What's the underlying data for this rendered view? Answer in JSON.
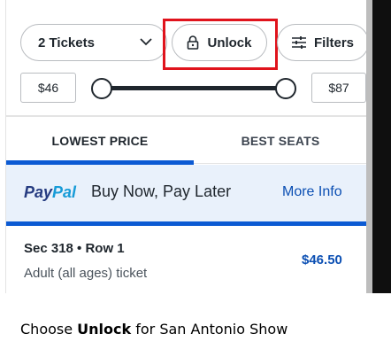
{
  "toolbar": {
    "ticket_select_label": "2 Tickets",
    "unlock_label": "Unlock",
    "filters_label": "Filters"
  },
  "price_range": {
    "min_label": "$46",
    "max_label": "$87",
    "min_value": 46,
    "max_value": 87
  },
  "tabs": [
    {
      "label": "LOWEST PRICE",
      "selected": true
    },
    {
      "label": "BEST SEATS",
      "selected": false
    }
  ],
  "paypal": {
    "logo_pay": "Pay",
    "logo_pal": "Pal",
    "tagline": "Buy Now, Pay Later",
    "more_info": "More Info"
  },
  "listing": {
    "section_row": "Sec 318 • Row 1",
    "ticket_type": "Adult (all ages) ticket",
    "price": "$46.50"
  },
  "caption": {
    "prefix": "Choose ",
    "emphasis": "Unlock",
    "suffix": " for San Antonio Show"
  },
  "colors": {
    "accent_blue": "#0b5ad3",
    "link_blue": "#0b4fb3",
    "highlight_red": "#e0131c",
    "paypal_band": "#e9f1fb"
  },
  "icons": {
    "ticket_select": "chevron-down-icon",
    "unlock": "lock-icon",
    "filters": "sliders-icon"
  }
}
